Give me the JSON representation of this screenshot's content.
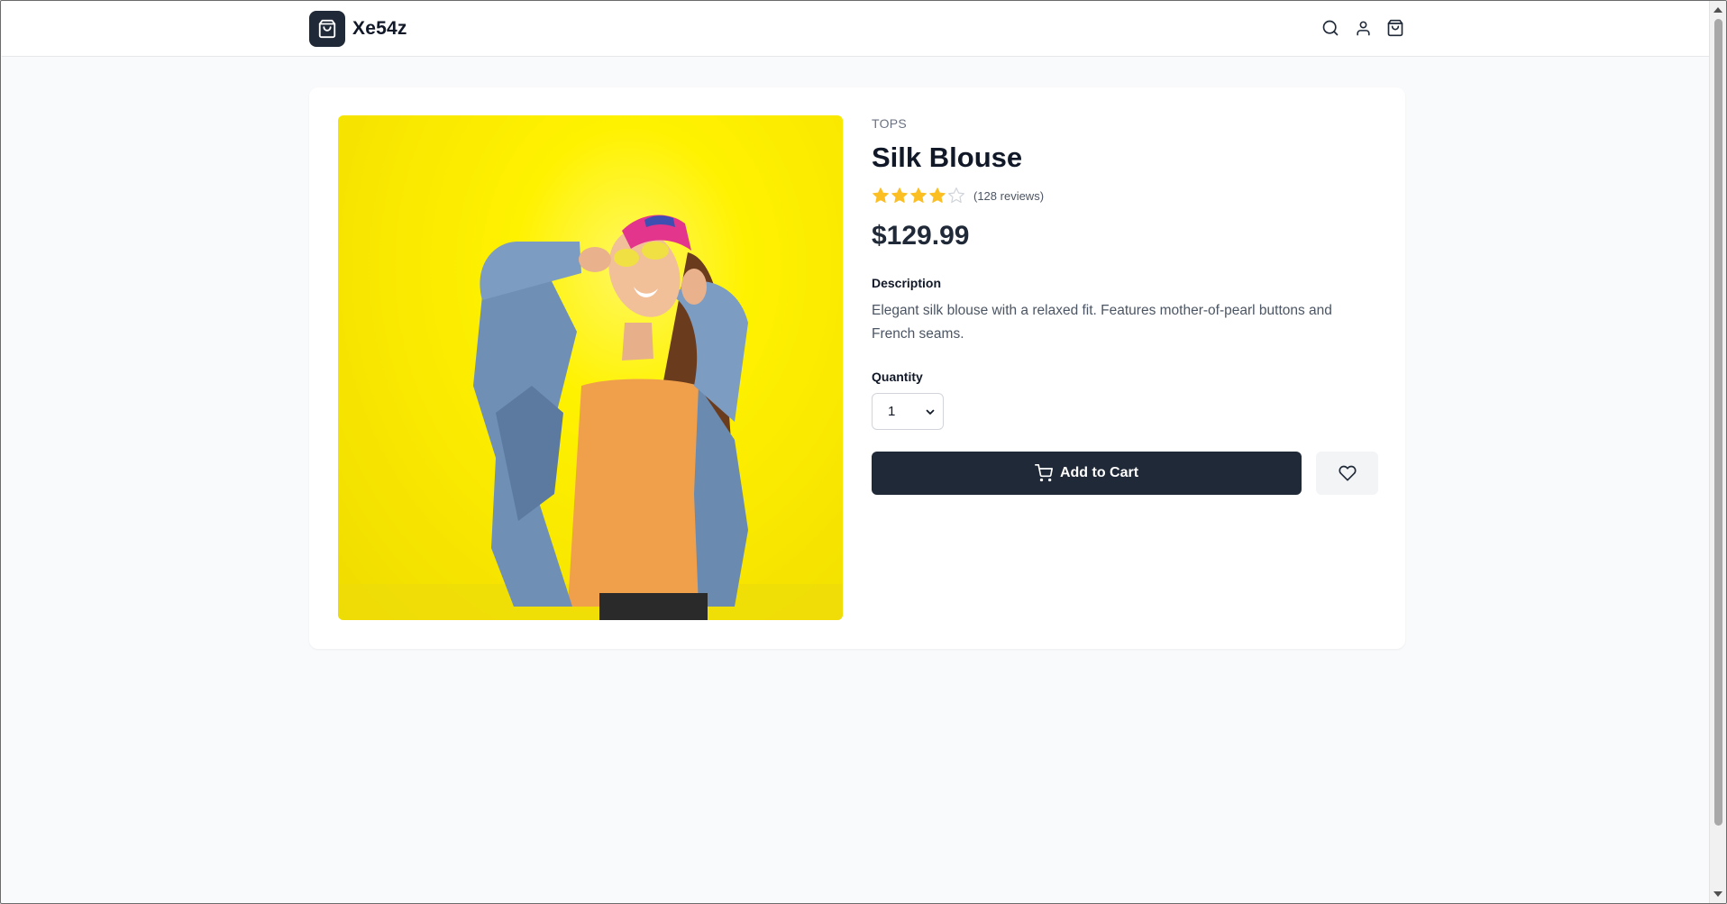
{
  "header": {
    "brand_name": "Xe54z",
    "icons": [
      "shopping-bag-icon",
      "search-icon",
      "user-icon",
      "cart-icon"
    ]
  },
  "product": {
    "category": "TOPS",
    "title": "Silk Blouse",
    "rating": 4,
    "rating_max": 5,
    "reviews": "(128 reviews)",
    "price": "$129.99",
    "description_label": "Description",
    "description": "Elegant silk blouse with a relaxed fit. Features mother-of-pearl buttons and French seams.",
    "quantity_label": "Quantity",
    "quantity_value": "1",
    "add_to_cart_label": "Add to Cart",
    "image_subject": "woman in denim jacket against yellow wall"
  },
  "colors": {
    "primary": "#1f2937",
    "star": "#fbbf24",
    "star_empty": "#d1d5db",
    "image_bg": "#fff200"
  }
}
